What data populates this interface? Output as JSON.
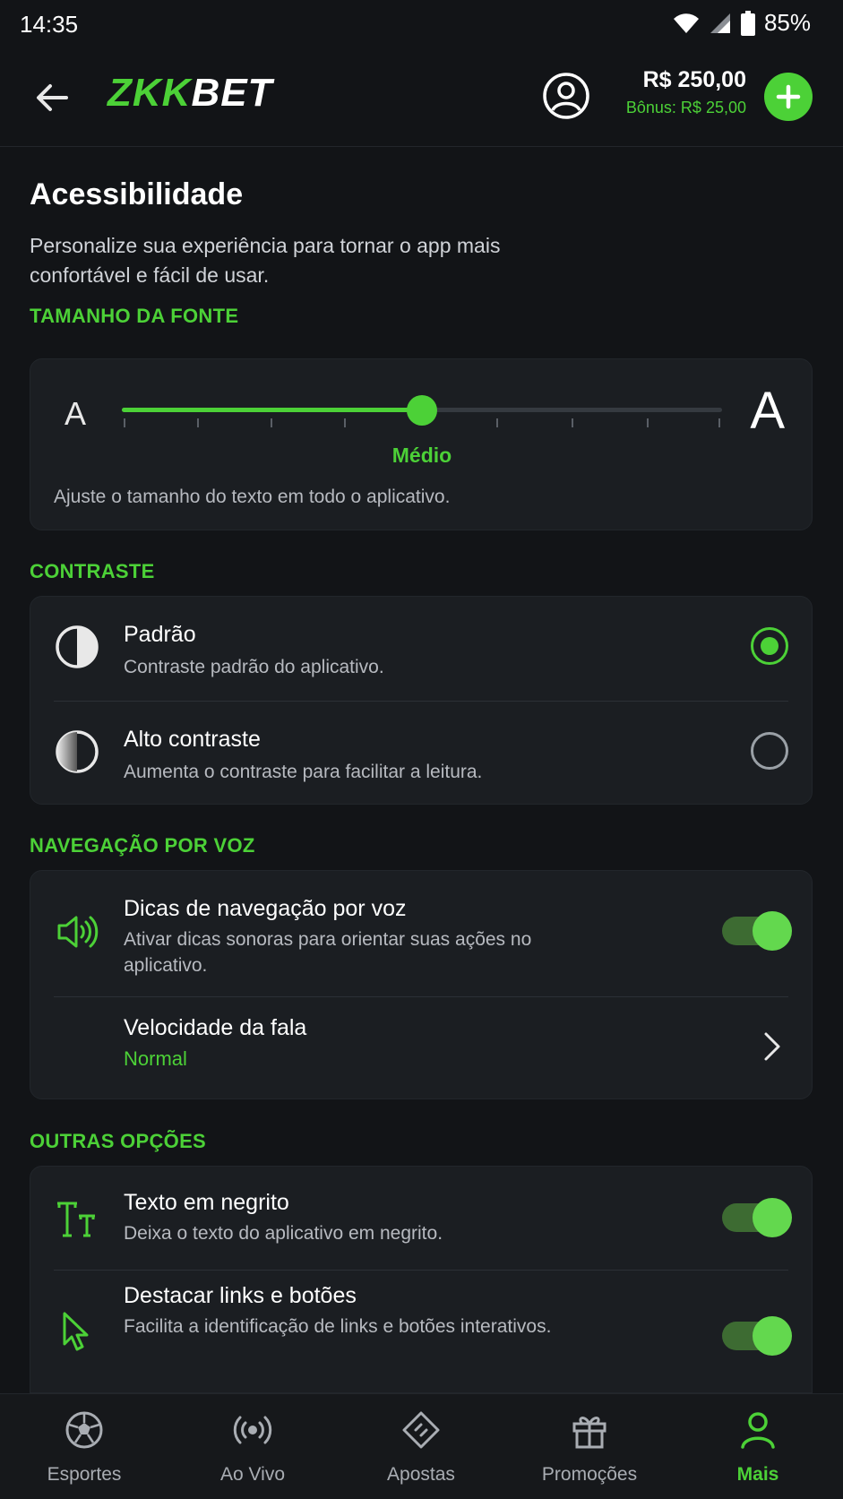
{
  "status_bar": {
    "time": "14:35",
    "battery": "85%"
  },
  "header": {
    "logo_prefix": "ZKK",
    "logo_suffix": "BET",
    "balance": "R$ 250,00",
    "bonus": "Bônus: R$ 25,00"
  },
  "page": {
    "title": "Acessibilidade",
    "subtitle": "Personalize sua experiência para tornar o app mais confortável e fácil de usar."
  },
  "font_size": {
    "section_label": "TAMANHO DA FONTE",
    "small_glyph": "A",
    "large_glyph": "A",
    "value_label": "Médio",
    "level": 0.5,
    "help": "Ajuste o tamanho do texto em todo o aplicativo."
  },
  "contrast": {
    "section_label": "CONTRASTE",
    "options": [
      {
        "title": "Padrão",
        "desc": "Contraste padrão do aplicativo.",
        "selected": true
      },
      {
        "title": "Alto contraste",
        "desc": "Aumenta o contraste para facilitar a leitura.",
        "selected": false
      }
    ]
  },
  "voice": {
    "section_label": "NAVEGAÇÃO POR VOZ",
    "hints_title": "Dicas de navegação por voz",
    "hints_desc": "Ativar dicas sonoras para orientar suas ações no aplicativo.",
    "hints_enabled": true,
    "speed_title": "Velocidade da fala",
    "speed_value": "Normal"
  },
  "other": {
    "section_label": "OUTRAS OPÇÕES",
    "bold_title": "Texto em negrito",
    "bold_desc": "Deixa o texto do aplicativo em negrito.",
    "bold_enabled": true,
    "links_title": "Destacar links e botões",
    "links_desc": "Facilita a identificação de links e botões interativos.",
    "links_enabled": true
  },
  "tabbar": {
    "tabs": [
      {
        "label": "Esportes",
        "icon": "soccer-ball-icon"
      },
      {
        "label": "Ao Vivo",
        "icon": "live-broadcast-icon"
      },
      {
        "label": "Apostas",
        "icon": "ticket-icon"
      },
      {
        "label": "Promoções",
        "icon": "gift-icon"
      },
      {
        "label": "Mais",
        "icon": "user-icon",
        "active": true
      }
    ]
  },
  "colors": {
    "accent": "#4cd137",
    "background": "#121417",
    "card": "#1b1e22"
  }
}
